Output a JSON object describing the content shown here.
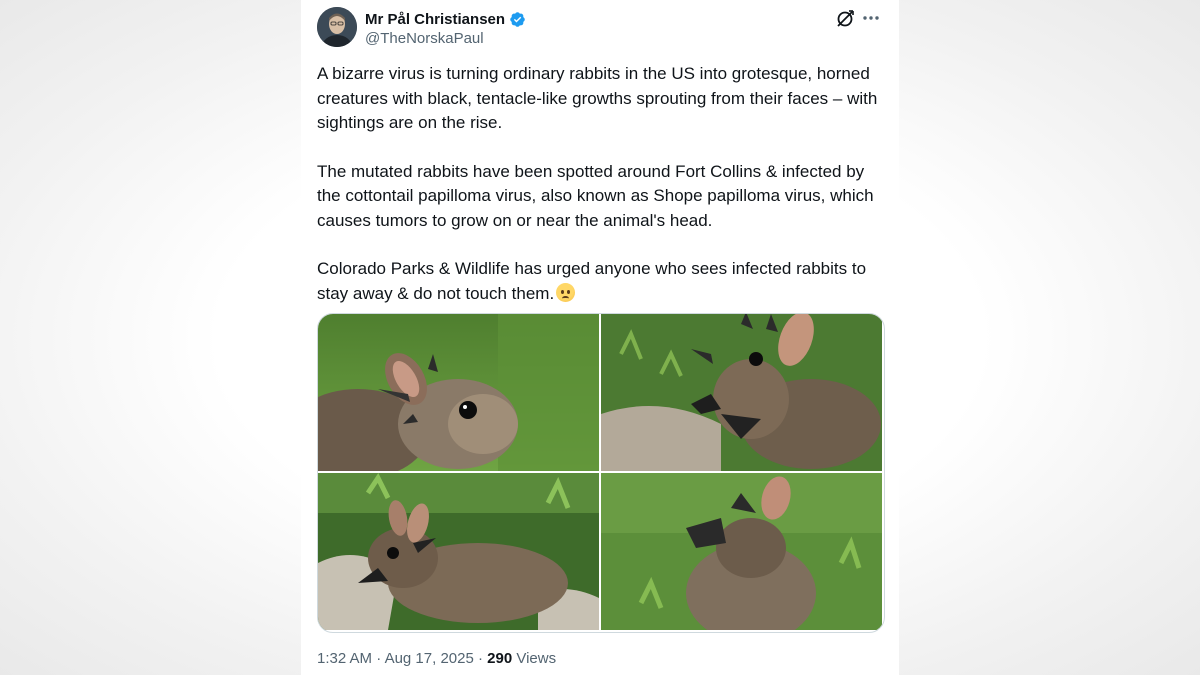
{
  "author": {
    "display_name": "Mr Pål Christiansen",
    "handle": "@TheNorskaPaul",
    "verified": true
  },
  "icons": {
    "verified": "verified-badge-icon",
    "grok": "grok-icon",
    "more": "more-options-icon",
    "emoji": "worried-face-emoji"
  },
  "tweet": {
    "paragraph_1": "A bizarre virus is turning ordinary rabbits in the US into grotesque, horned creatures with black, tentacle-like growths sprouting from their faces – with sightings are on the rise.",
    "paragraph_2": "The mutated rabbits have been spotted around Fort Collins & infected by the cottontail papilloma virus, also known as Shope papilloma virus, which causes tumors to grow on or near the animal's head.",
    "paragraph_3": "Colorado Parks & Wildlife has urged anyone who sees infected rabbits to stay away & do not touch them."
  },
  "media": {
    "count": 4
  },
  "meta": {
    "time": "1:32 AM",
    "separator": "·",
    "date": "Aug 17, 2025",
    "views_count": "290",
    "views_label": "Views"
  },
  "colors": {
    "text_primary": "#0f1419",
    "text_secondary": "#536471",
    "verified_blue": "#1d9bf0",
    "border": "#cfd9de"
  }
}
